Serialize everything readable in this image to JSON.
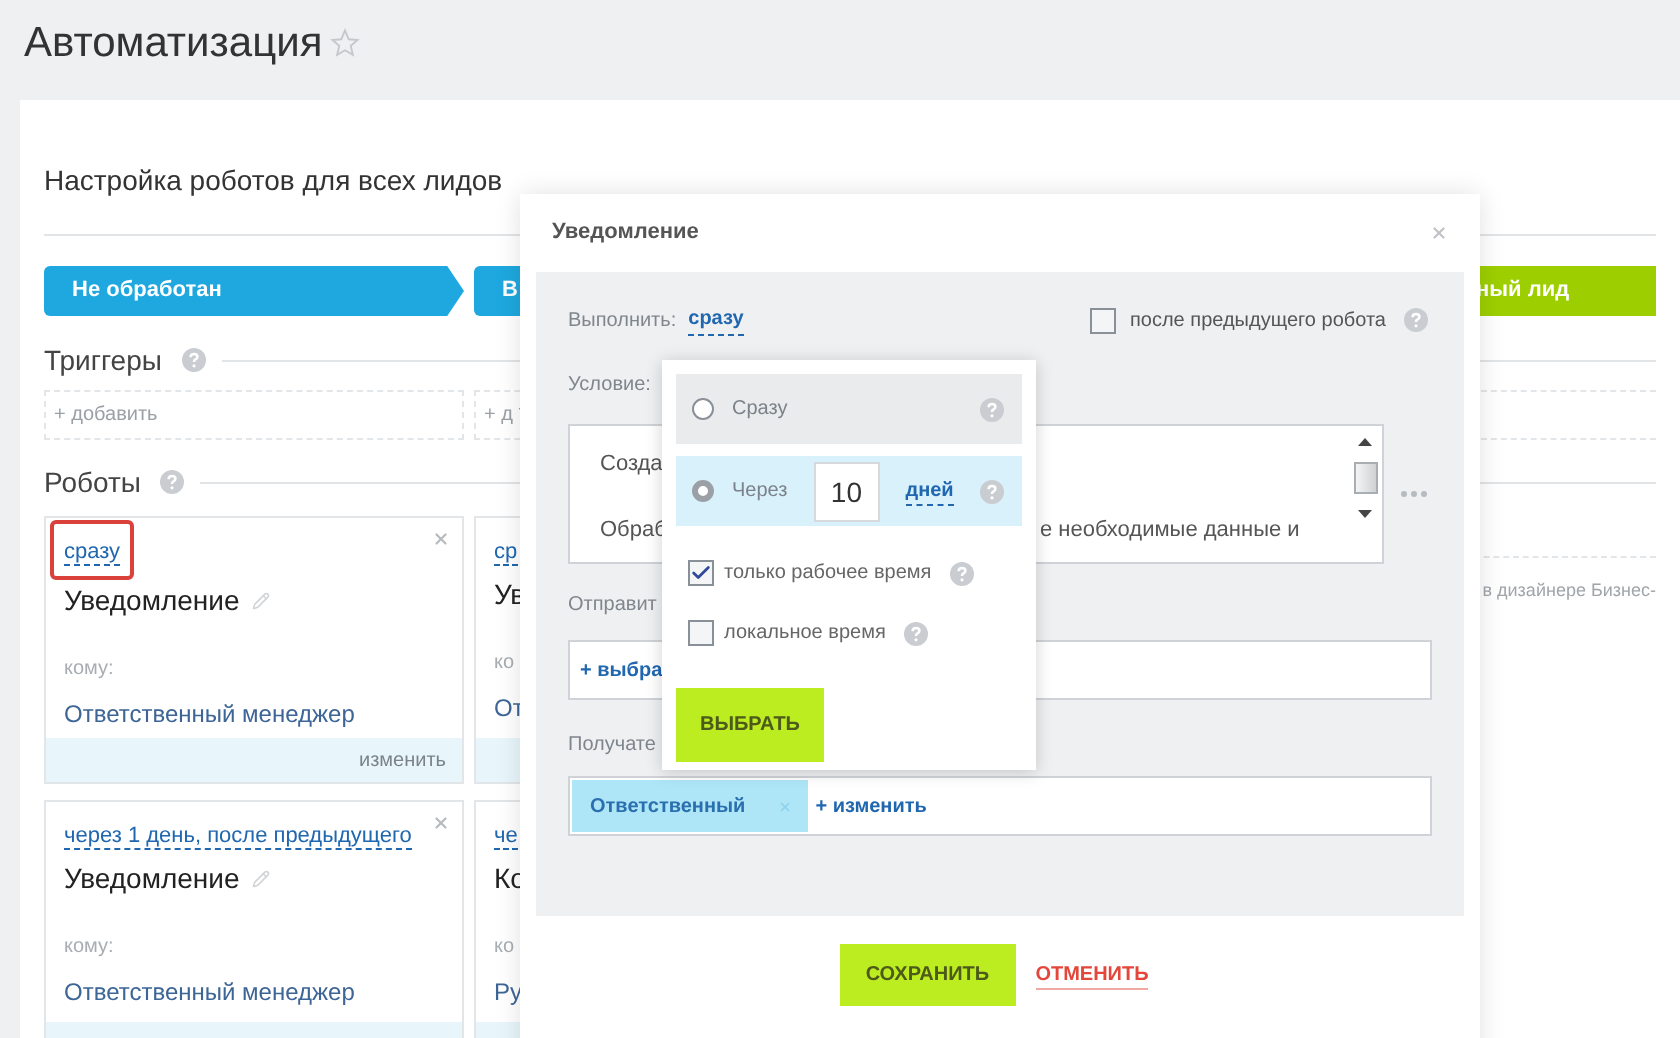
{
  "page_title": "Автоматизация",
  "panel": {
    "heading": "Настройка роботов для всех лидов",
    "stages": [
      {
        "label": "Не обработан",
        "color": "#1ea8df"
      },
      {
        "label": "В",
        "color": "#1ea8df"
      },
      {
        "label": "ный лид",
        "color": "#9dcf00"
      }
    ],
    "triggers": {
      "title": "Триггеры",
      "slots": [
        "+ добавить",
        "+ д"
      ]
    },
    "robots": {
      "title": "Роботы",
      "cards": [
        {
          "delay": "сразу",
          "highlighted": true,
          "name": "Уведомление",
          "to_label": "кому:",
          "to": "Ответственный менеджер",
          "footer": "изменить"
        },
        {
          "delay": "ср",
          "highlighted": false,
          "name": "Ув",
          "to_label": "ко",
          "to": "От"
        },
        {
          "delay": "через 1 день, после предыдущего",
          "highlighted": false,
          "name": "Уведомление",
          "to_label": "кому:",
          "to": "Ответственный менеджер"
        },
        {
          "delay": "че",
          "highlighted": false,
          "name": "Ко",
          "to_label": "ко",
          "to": "Ру"
        }
      ]
    },
    "side_note": "в дизайнере Бизнес-"
  },
  "dialog": {
    "title": "Уведомление",
    "run_label": "Выполнить:",
    "run_value": "сразу",
    "after_previous": {
      "label": "после предыдущего робота",
      "checked": false
    },
    "condition_label": "Условие:",
    "message": {
      "line_1": "Созда",
      "line_2_start": "Обраб",
      "line_2_end": "е необходимые данные и"
    },
    "sender": {
      "label": "Отправит",
      "action": "+ выбра"
    },
    "recipient": {
      "label": "Получате",
      "chips": [
        "Ответственный"
      ],
      "action": "+ изменить"
    },
    "save": "СОХРАНИТЬ",
    "cancel": "ОТМЕНИТЬ"
  },
  "delay_popup": {
    "options": [
      {
        "kind": "immediate",
        "label": "Сразу",
        "selected": false
      },
      {
        "kind": "after",
        "label": "Через",
        "selected": true,
        "amount": "10",
        "unit": "дней"
      }
    ],
    "checks": [
      {
        "label": "только рабочее время",
        "checked": true
      },
      {
        "label": "локальное время",
        "checked": false
      }
    ],
    "button": "ВЫБРАТЬ"
  }
}
